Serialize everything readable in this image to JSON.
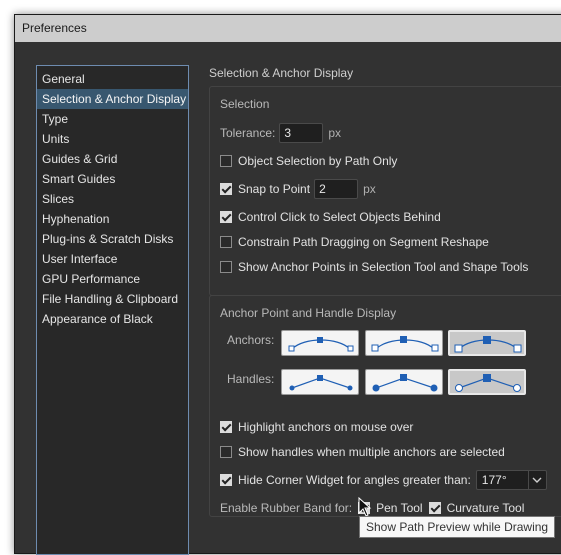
{
  "window": {
    "title": "Preferences"
  },
  "sidebar": {
    "items": [
      {
        "label": "General"
      },
      {
        "label": "Selection & Anchor Display",
        "selected": true
      },
      {
        "label": "Type"
      },
      {
        "label": "Units"
      },
      {
        "label": "Guides & Grid"
      },
      {
        "label": "Smart Guides"
      },
      {
        "label": "Slices"
      },
      {
        "label": "Hyphenation"
      },
      {
        "label": "Plug-ins & Scratch Disks"
      },
      {
        "label": "User Interface"
      },
      {
        "label": "GPU Performance"
      },
      {
        "label": "File Handling & Clipboard"
      },
      {
        "label": "Appearance of Black"
      }
    ]
  },
  "main": {
    "section_title": "Selection & Anchor Display",
    "selection": {
      "title": "Selection",
      "tolerance_label": "Tolerance:",
      "tolerance_value": "3",
      "tolerance_unit": "px",
      "object_selection_by_path": {
        "label": "Object Selection by Path Only",
        "checked": false
      },
      "snap_to_point": {
        "label": "Snap to Point",
        "checked": true,
        "value": "2",
        "unit": "px"
      },
      "control_click": {
        "label": "Control Click to Select Objects Behind",
        "checked": true
      },
      "constrain_path": {
        "label": "Constrain Path Dragging on Segment Reshape",
        "checked": false
      },
      "show_anchor_points": {
        "label": "Show Anchor Points in Selection Tool and Shape Tools",
        "checked": false
      }
    },
    "anchor_display": {
      "title": "Anchor Point and Handle Display",
      "anchors_label": "Anchors:",
      "handles_label": "Handles:",
      "selected_anchor_style": 3,
      "selected_handle_style": 3,
      "highlight_anchors": {
        "label": "Highlight anchors on mouse over",
        "checked": true
      },
      "show_handles_multiple": {
        "label": "Show handles when multiple anchors are selected",
        "checked": false
      },
      "hide_corner_widget": {
        "label": "Hide Corner Widget for angles greater than:",
        "checked": true,
        "value": "177°"
      },
      "rubber_band": {
        "label": "Enable Rubber Band for:",
        "pen_tool": {
          "label": "Pen Tool",
          "checked": true
        },
        "curvature_tool": {
          "label": "Curvature Tool",
          "checked": true
        }
      }
    }
  },
  "tooltip": {
    "text": "Show Path Preview while Drawing"
  },
  "colors": {
    "accent": "#38576f",
    "focus_border": "#6e8cb0",
    "glyph_blue": "#1f5fb4"
  },
  "icons": [
    "checkbox-checked-icon",
    "checkbox-unchecked-icon",
    "chevron-down-icon",
    "mouse-pointer-icon"
  ]
}
